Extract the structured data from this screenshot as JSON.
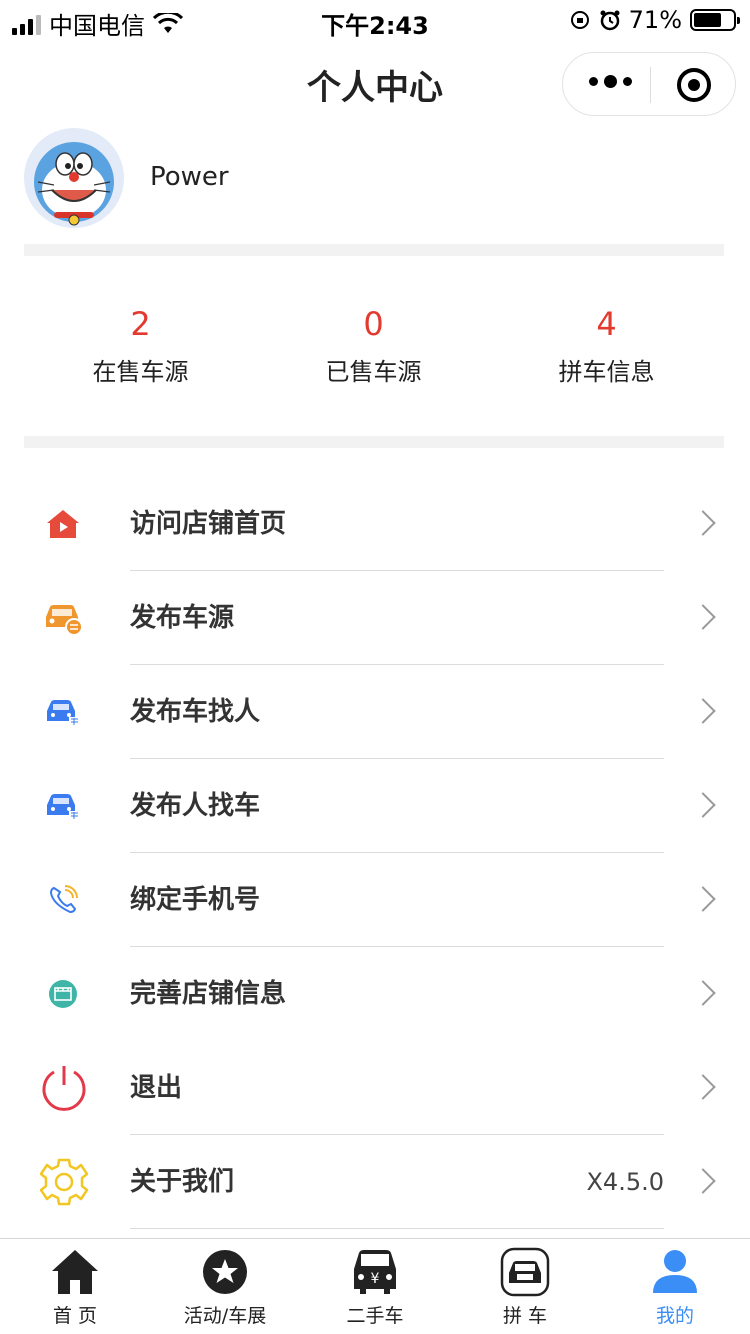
{
  "status_bar": {
    "carrier": "中国电信",
    "time": "下午2:43",
    "battery": "71%",
    "battery_level": 0.71
  },
  "nav": {
    "title": "个人中心"
  },
  "profile": {
    "username": "Power"
  },
  "stats": [
    {
      "value": "2",
      "label": "在售车源"
    },
    {
      "value": "0",
      "label": "已售车源"
    },
    {
      "value": "4",
      "label": "拼车信息"
    }
  ],
  "menu": [
    {
      "label": "访问店铺首页",
      "icon": "shop-home-icon",
      "color": "#e64a3b",
      "value": ""
    },
    {
      "label": "发布车源",
      "icon": "car-publish-icon",
      "color": "#f0962e",
      "value": ""
    },
    {
      "label": "发布车找人",
      "icon": "carpool-car-icon",
      "color": "#3a7bf0",
      "value": ""
    },
    {
      "label": "发布人找车",
      "icon": "carpool-person-icon",
      "color": "#3a7bf0",
      "value": ""
    },
    {
      "label": "绑定手机号",
      "icon": "phone-icon",
      "color": "#3a7bf0",
      "value": ""
    },
    {
      "label": "完善店铺信息",
      "icon": "store-info-icon",
      "color": "#3fb5a8",
      "value": ""
    },
    {
      "label": "退出",
      "icon": "power-icon",
      "color": "#e23a4a",
      "value": ""
    },
    {
      "label": "关于我们",
      "icon": "gear-icon",
      "color": "#f2c623",
      "value": "X4.5.0"
    }
  ],
  "tabbar": [
    {
      "label": "首 页",
      "icon": "home-icon",
      "active": false
    },
    {
      "label": "活动/车展",
      "icon": "star-icon",
      "active": false
    },
    {
      "label": "二手车",
      "icon": "used-car-icon",
      "active": false
    },
    {
      "label": "拼 车",
      "icon": "carpool-tab-icon",
      "active": false
    },
    {
      "label": "我的",
      "icon": "user-icon",
      "active": true
    }
  ],
  "colors": {
    "accent_red": "#e23a2f",
    "tab_active": "#3a8ef5"
  }
}
